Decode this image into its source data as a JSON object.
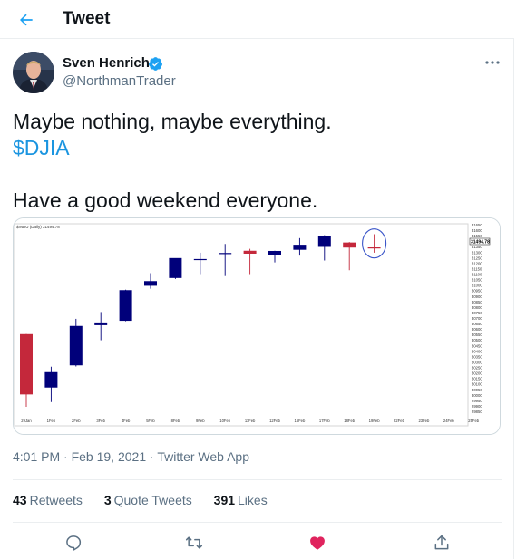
{
  "header": {
    "title": "Tweet",
    "back_icon": "arrow-left-icon"
  },
  "author": {
    "name": "Sven Henrich",
    "handle": "@NorthmanTrader",
    "verified": true
  },
  "tweet": {
    "line1": "Maybe nothing, maybe everything.",
    "cashtag": "$DJIA",
    "line3": "Have a good weekend everyone."
  },
  "meta": {
    "time": "4:01 PM",
    "sep1": " · ",
    "date": "Feb 19, 2021",
    "sep2": " · ",
    "source": "Twitter Web App"
  },
  "stats": {
    "retweets_count": "43",
    "retweets_label": "Retweets",
    "quotes_count": "3",
    "quotes_label": "Quote Tweets",
    "likes_count": "391",
    "likes_label": "Likes"
  },
  "colors": {
    "accent": "#1da1f2",
    "like": "#e0245e",
    "up_candle": "#00007a",
    "down_candle": "#c4283b"
  },
  "chart_data": {
    "type": "candlestick",
    "symbol_label": "$INDU (Daily) 31494.78",
    "last_price_label": "31494.78",
    "ylim": [
      29800,
      31700
    ],
    "x_ticks": [
      "29Jan",
      "1Feb",
      "2Feb",
      "3Feb",
      "4Feb",
      "5Feb",
      "8Feb",
      "9Feb",
      "10Feb",
      "11Feb",
      "12Feb",
      "16Feb",
      "17Feb",
      "18Feb",
      "19Feb",
      "22Feb",
      "23Feb",
      "24Feb",
      "25Feb"
    ],
    "y_ticks": [
      "31650",
      "31600",
      "31550",
      "31400",
      "31350",
      "31300",
      "31250",
      "31200",
      "31150",
      "31100",
      "31050",
      "31000",
      "30950",
      "30900",
      "30850",
      "30800",
      "30750",
      "30700",
      "30650",
      "30600",
      "30550",
      "30500",
      "30450",
      "30400",
      "30350",
      "30300",
      "30250",
      "30200",
      "30150",
      "30100",
      "30050",
      "30000",
      "29950",
      "29900",
      "29850"
    ],
    "candles": [
      {
        "date": "29Jan",
        "open": 30603,
        "high": 30605,
        "low": 29856,
        "close": 29983
      },
      {
        "date": "1Feb",
        "open": 30054,
        "high": 30268,
        "low": 29905,
        "close": 30212
      },
      {
        "date": "2Feb",
        "open": 30282,
        "high": 30760,
        "low": 30270,
        "close": 30687
      },
      {
        "date": "3Feb",
        "open": 30695,
        "high": 30830,
        "low": 30540,
        "close": 30723
      },
      {
        "date": "4Feb",
        "open": 30740,
        "high": 31060,
        "low": 30735,
        "close": 31055
      },
      {
        "date": "5Feb",
        "open": 31100,
        "high": 31230,
        "low": 31070,
        "close": 31148
      },
      {
        "date": "8Feb",
        "open": 31180,
        "high": 31380,
        "low": 31170,
        "close": 31385
      },
      {
        "date": "9Feb",
        "open": 31375,
        "high": 31440,
        "low": 31220,
        "close": 31375
      },
      {
        "date": "10Feb",
        "open": 31437,
        "high": 31530,
        "low": 31200,
        "close": 31437
      },
      {
        "date": "11Feb",
        "open": 31460,
        "high": 31480,
        "low": 31220,
        "close": 31430
      },
      {
        "date": "12Feb",
        "open": 31420,
        "high": 31460,
        "low": 31340,
        "close": 31458
      },
      {
        "date": "16Feb",
        "open": 31470,
        "high": 31590,
        "low": 31410,
        "close": 31522
      },
      {
        "date": "17Feb",
        "open": 31500,
        "high": 31620,
        "low": 31360,
        "close": 31613
      },
      {
        "date": "18Feb",
        "open": 31545,
        "high": 31550,
        "low": 31260,
        "close": 31493
      },
      {
        "date": "19Feb",
        "open": 31495,
        "high": 31630,
        "low": 31440,
        "close": 31494
      }
    ],
    "annotation": "circle around 19Feb candle",
    "grid": false
  }
}
